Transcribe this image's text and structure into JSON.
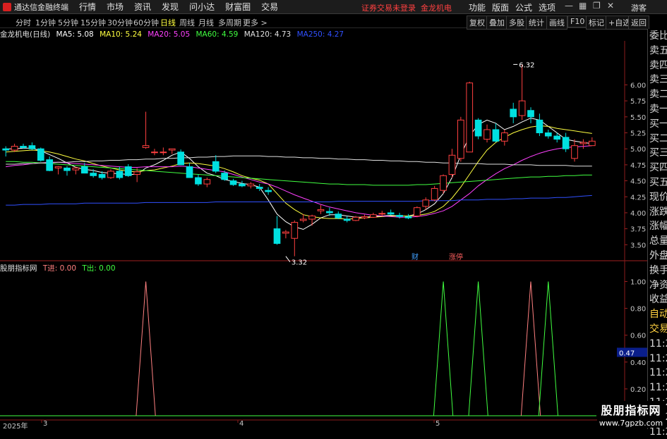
{
  "app": {
    "title": "通达信金融终端",
    "menu": [
      "行情",
      "市场",
      "资讯",
      "发现",
      "问小达",
      "财富圈",
      "交易"
    ],
    "status_msg": "证券交易未登录",
    "stock_name": "金龙机电",
    "right_menu": [
      "功能",
      "版面",
      "公式",
      "选项"
    ],
    "guest": "游客",
    "colors": {
      "up": "#ff4040",
      "down": "#00e0e0",
      "accent": "#ffff40"
    }
  },
  "periods": {
    "items": [
      "分时",
      "1分钟",
      "5分钟",
      "15分钟",
      "30分钟",
      "60分钟",
      "日线",
      "周线",
      "月线",
      "多周期",
      "更多 >"
    ],
    "active": "日线"
  },
  "tools": [
    "复权",
    "叠加",
    "多股",
    "统计",
    "画线",
    "F10",
    "标记",
    "+自选",
    "返回"
  ],
  "ma_legend": {
    "title": "金龙机电(日线)",
    "items": [
      {
        "label": "MA5: 5.08",
        "color": "#ffffff"
      },
      {
        "label": "MA10: 5.24",
        "color": "#ffff40"
      },
      {
        "label": "MA20: 5.05",
        "color": "#ff40ff"
      },
      {
        "label": "MA60: 4.59",
        "color": "#40ff40"
      },
      {
        "label": "MA120: 4.73",
        "color": "#e0e0e0"
      },
      {
        "label": "MA250: 4.27",
        "color": "#3050ff"
      }
    ]
  },
  "indicator_legend": {
    "title": "股朋指标网",
    "items": [
      {
        "label": "T进: 0.00",
        "color": "#ff8080"
      },
      {
        "label": "T出: 0.00",
        "color": "#40ff40"
      }
    ]
  },
  "side_panel": [
    "委比",
    "卖五",
    "卖四",
    "卖三",
    "卖二",
    "卖一",
    "买一",
    "买二",
    "买三",
    "买四",
    "买五",
    "现价",
    "涨跌",
    "涨幅",
    "总量",
    "外盘",
    "换手",
    "净资",
    "收益",
    "自动",
    "交易",
    "11:29",
    "11:29",
    "11:29",
    "11:29",
    "11:29",
    "11:29",
    "11:29"
  ],
  "brand": {
    "name": "股朋指标网",
    "url": "www.7gpzb.com"
  },
  "date_axis": [
    "2025年",
    "3",
    "4",
    "5"
  ],
  "chart_data": [
    {
      "type": "candlestick",
      "title": "金龙机电(日线)",
      "ylim": [
        3.25,
        6.6
      ],
      "yticks": [
        3.5,
        3.75,
        4.0,
        4.25,
        4.5,
        4.75,
        5.0,
        5.25,
        5.5,
        5.75,
        6.0
      ],
      "annotations": [
        {
          "label": "6.32",
          "value": 6.32,
          "index": 58
        },
        {
          "label": "3.32",
          "value": 3.32,
          "index": 32
        }
      ],
      "event_tags": [
        "财",
        "涨停"
      ],
      "candles": [
        [
          5.0,
          5.04,
          4.88,
          4.98
        ],
        [
          4.98,
          5.08,
          4.95,
          5.04
        ],
        [
          5.04,
          5.08,
          5.0,
          5.02
        ],
        [
          5.05,
          5.1,
          4.98,
          5.0
        ],
        [
          5.0,
          5.02,
          4.8,
          4.82
        ],
        [
          4.83,
          4.88,
          4.65,
          4.66
        ],
        [
          4.7,
          4.73,
          4.6,
          4.72
        ],
        [
          4.7,
          4.73,
          4.58,
          4.66
        ],
        [
          4.67,
          4.72,
          4.6,
          4.7
        ],
        [
          4.72,
          4.78,
          4.62,
          4.62
        ],
        [
          4.62,
          4.68,
          4.55,
          4.58
        ],
        [
          4.6,
          4.65,
          4.52,
          4.55
        ],
        [
          4.55,
          4.68,
          4.53,
          4.65
        ],
        [
          4.65,
          4.72,
          4.52,
          4.55
        ],
        [
          4.72,
          4.76,
          4.56,
          4.58
        ],
        [
          4.6,
          4.7,
          4.48,
          4.64
        ],
        [
          5.02,
          5.58,
          5.0,
          5.05
        ],
        [
          4.95,
          5.0,
          4.9,
          4.95
        ],
        [
          4.95,
          5.02,
          4.9,
          4.95
        ],
        [
          4.98,
          5.0,
          4.92,
          5.0
        ],
        [
          4.95,
          4.99,
          4.75,
          4.75
        ],
        [
          4.72,
          4.78,
          4.55,
          4.55
        ],
        [
          4.55,
          4.6,
          4.42,
          4.45
        ],
        [
          4.45,
          4.55,
          4.4,
          4.52
        ],
        [
          4.8,
          4.9,
          4.62,
          4.65
        ],
        [
          4.62,
          4.66,
          4.5,
          4.52
        ],
        [
          4.5,
          4.53,
          4.42,
          4.44
        ],
        [
          4.45,
          4.5,
          4.4,
          4.42
        ],
        [
          4.42,
          4.48,
          4.38,
          4.45
        ],
        [
          4.4,
          4.45,
          4.34,
          4.38
        ],
        [
          4.35,
          4.4,
          4.28,
          4.33
        ],
        [
          3.75,
          3.95,
          3.5,
          3.52
        ],
        [
          3.68,
          3.73,
          3.6,
          3.7
        ],
        [
          3.6,
          3.88,
          3.32,
          3.85
        ],
        [
          3.88,
          3.98,
          3.85,
          3.9
        ],
        [
          3.9,
          3.97,
          3.8,
          3.95
        ],
        [
          4.03,
          4.12,
          3.98,
          4.05
        ],
        [
          4.02,
          4.08,
          3.95,
          4.0
        ],
        [
          3.98,
          4.02,
          3.9,
          3.92
        ],
        [
          3.9,
          3.95,
          3.85,
          3.88
        ],
        [
          3.88,
          3.95,
          3.87,
          3.93
        ],
        [
          3.92,
          3.97,
          3.9,
          3.94
        ],
        [
          3.93,
          4.0,
          3.92,
          3.97
        ],
        [
          3.98,
          4.03,
          3.95,
          3.99
        ],
        [
          4.0,
          4.05,
          3.96,
          3.98
        ],
        [
          3.96,
          4.0,
          3.91,
          3.94
        ],
        [
          3.94,
          3.98,
          3.9,
          3.92
        ],
        [
          3.95,
          4.1,
          3.93,
          4.08
        ],
        [
          4.1,
          4.24,
          4.05,
          4.2
        ],
        [
          4.2,
          4.42,
          4.18,
          4.38
        ],
        [
          4.35,
          4.6,
          4.3,
          4.58
        ],
        [
          4.6,
          5.0,
          4.55,
          4.9
        ],
        [
          4.85,
          5.5,
          4.8,
          5.45
        ],
        [
          4.95,
          6.05,
          4.95,
          6.03
        ],
        [
          5.45,
          5.48,
          5.15,
          5.2
        ],
        [
          5.15,
          5.38,
          5.1,
          5.3
        ],
        [
          5.3,
          5.4,
          5.1,
          5.12
        ],
        [
          5.12,
          5.3,
          5.05,
          5.25
        ],
        [
          5.62,
          5.72,
          5.4,
          5.5
        ],
        [
          5.52,
          6.32,
          5.45,
          5.75
        ],
        [
          5.6,
          5.65,
          5.4,
          5.5
        ],
        [
          5.45,
          5.55,
          5.2,
          5.25
        ],
        [
          5.25,
          5.3,
          5.16,
          5.2
        ],
        [
          5.2,
          5.25,
          5.1,
          5.15
        ],
        [
          5.18,
          5.25,
          4.95,
          5.0
        ],
        [
          4.85,
          5.15,
          4.8,
          5.05
        ],
        [
          5.08,
          5.15,
          5.0,
          5.1
        ],
        [
          5.05,
          5.18,
          5.05,
          5.12
        ]
      ],
      "series": [
        {
          "name": "MA5",
          "color": "#ffffff",
          "values": [
            5.0,
            5.0,
            5.01,
            5.01,
            4.97,
            4.91,
            4.85,
            4.78,
            4.71,
            4.68,
            4.66,
            4.63,
            4.62,
            4.61,
            4.6,
            4.6,
            4.7,
            4.75,
            4.82,
            4.9,
            4.95,
            4.85,
            4.72,
            4.62,
            4.58,
            4.52,
            4.49,
            4.46,
            4.44,
            4.4,
            4.2,
            3.98,
            3.86,
            3.78,
            3.74,
            3.82,
            3.92,
            3.97,
            3.97,
            3.95,
            3.93,
            3.93,
            3.94,
            3.95,
            3.96,
            3.95,
            3.95,
            3.98,
            4.05,
            4.14,
            4.3,
            4.55,
            4.9,
            5.2,
            5.38,
            5.45,
            5.4,
            5.3,
            5.35,
            5.42,
            5.48,
            5.45,
            5.35,
            5.25,
            5.15,
            5.12,
            5.1,
            5.08
          ]
        },
        {
          "name": "MA10",
          "color": "#ffff40",
          "values": [
            4.95,
            4.96,
            4.97,
            4.98,
            4.97,
            4.95,
            4.92,
            4.88,
            4.84,
            4.81,
            4.77,
            4.73,
            4.7,
            4.67,
            4.65,
            4.64,
            4.66,
            4.67,
            4.7,
            4.73,
            4.77,
            4.78,
            4.77,
            4.75,
            4.73,
            4.69,
            4.64,
            4.58,
            4.54,
            4.51,
            4.45,
            4.3,
            4.15,
            4.05,
            3.97,
            3.94,
            3.92,
            3.91,
            3.91,
            3.9,
            3.91,
            3.92,
            3.93,
            3.94,
            3.95,
            3.95,
            3.95,
            3.96,
            3.98,
            4.02,
            4.1,
            4.23,
            4.4,
            4.6,
            4.8,
            4.98,
            5.1,
            5.18,
            5.25,
            5.3,
            5.34,
            5.36,
            5.35,
            5.32,
            5.3,
            5.28,
            5.26,
            5.24
          ]
        },
        {
          "name": "MA20",
          "color": "#ff40ff",
          "values": [
            4.72,
            4.74,
            4.75,
            4.77,
            4.78,
            4.79,
            4.79,
            4.78,
            4.77,
            4.76,
            4.75,
            4.74,
            4.73,
            4.72,
            4.71,
            4.71,
            4.72,
            4.72,
            4.72,
            4.72,
            4.73,
            4.72,
            4.7,
            4.68,
            4.66,
            4.64,
            4.6,
            4.56,
            4.52,
            4.48,
            4.45,
            4.4,
            4.34,
            4.28,
            4.23,
            4.18,
            4.13,
            4.09,
            4.06,
            4.03,
            4.0,
            3.98,
            3.96,
            3.95,
            3.94,
            3.93,
            3.93,
            3.94,
            3.96,
            3.99,
            4.03,
            4.1,
            4.2,
            4.3,
            4.42,
            4.52,
            4.61,
            4.69,
            4.75,
            4.82,
            4.88,
            4.93,
            4.97,
            5.0,
            5.02,
            5.03,
            5.04,
            5.05
          ]
        },
        {
          "name": "MA60",
          "color": "#40ff40",
          "values": [
            4.8,
            4.8,
            4.79,
            4.79,
            4.78,
            4.77,
            4.76,
            4.75,
            4.74,
            4.73,
            4.72,
            4.71,
            4.7,
            4.69,
            4.68,
            4.67,
            4.66,
            4.65,
            4.64,
            4.63,
            4.62,
            4.61,
            4.6,
            4.59,
            4.58,
            4.57,
            4.56,
            4.55,
            4.54,
            4.53,
            4.52,
            4.51,
            4.5,
            4.49,
            4.48,
            4.47,
            4.46,
            4.45,
            4.45,
            4.44,
            4.44,
            4.44,
            4.43,
            4.43,
            4.43,
            4.43,
            4.43,
            4.44,
            4.44,
            4.45,
            4.46,
            4.47,
            4.48,
            4.49,
            4.5,
            4.51,
            4.52,
            4.53,
            4.54,
            4.55,
            4.56,
            4.56,
            4.57,
            4.57,
            4.58,
            4.58,
            4.59,
            4.59
          ]
        },
        {
          "name": "MA120",
          "color": "#e0e0e0",
          "values": [
            4.76,
            4.76,
            4.77,
            4.77,
            4.78,
            4.78,
            4.79,
            4.79,
            4.8,
            4.8,
            4.81,
            4.81,
            4.82,
            4.82,
            4.83,
            4.83,
            4.84,
            4.84,
            4.85,
            4.85,
            4.86,
            4.86,
            4.87,
            4.87,
            4.88,
            4.88,
            4.89,
            4.89,
            4.89,
            4.89,
            4.88,
            4.88,
            4.87,
            4.87,
            4.86,
            4.86,
            4.85,
            4.85,
            4.84,
            4.84,
            4.83,
            4.83,
            4.82,
            4.82,
            4.81,
            4.81,
            4.8,
            4.8,
            4.79,
            4.79,
            4.78,
            4.78,
            4.77,
            4.77,
            4.77,
            4.76,
            4.76,
            4.76,
            4.75,
            4.75,
            4.75,
            4.74,
            4.74,
            4.74,
            4.74,
            4.73,
            4.73,
            4.73
          ]
        },
        {
          "name": "MA250",
          "color": "#3050ff",
          "values": [
            4.12,
            4.12,
            4.13,
            4.13,
            4.13,
            4.14,
            4.14,
            4.14,
            4.14,
            4.15,
            4.15,
            4.15,
            4.15,
            4.15,
            4.15,
            4.15,
            4.16,
            4.16,
            4.16,
            4.16,
            4.16,
            4.16,
            4.16,
            4.16,
            4.17,
            4.17,
            4.17,
            4.17,
            4.17,
            4.17,
            4.17,
            4.17,
            4.17,
            4.17,
            4.17,
            4.17,
            4.17,
            4.17,
            4.18,
            4.18,
            4.18,
            4.18,
            4.18,
            4.18,
            4.18,
            4.18,
            4.18,
            4.18,
            4.19,
            4.19,
            4.19,
            4.19,
            4.2,
            4.2,
            4.2,
            4.21,
            4.21,
            4.21,
            4.22,
            4.22,
            4.23,
            4.23,
            4.23,
            4.24,
            4.24,
            4.25,
            4.26,
            4.27
          ]
        }
      ]
    },
    {
      "type": "line",
      "title": "股朋指标网",
      "ylim": [
        0,
        1.05
      ],
      "yticks": [
        1.0,
        0.8,
        0.6,
        0.4,
        0.2
      ],
      "current_value_label": "0.47",
      "series": [
        {
          "name": "T进",
          "color": "#ff8080",
          "spikes": [
            16,
            60
          ]
        },
        {
          "name": "T出",
          "color": "#40ff40",
          "spikes": [
            50,
            54,
            62
          ]
        }
      ]
    }
  ]
}
